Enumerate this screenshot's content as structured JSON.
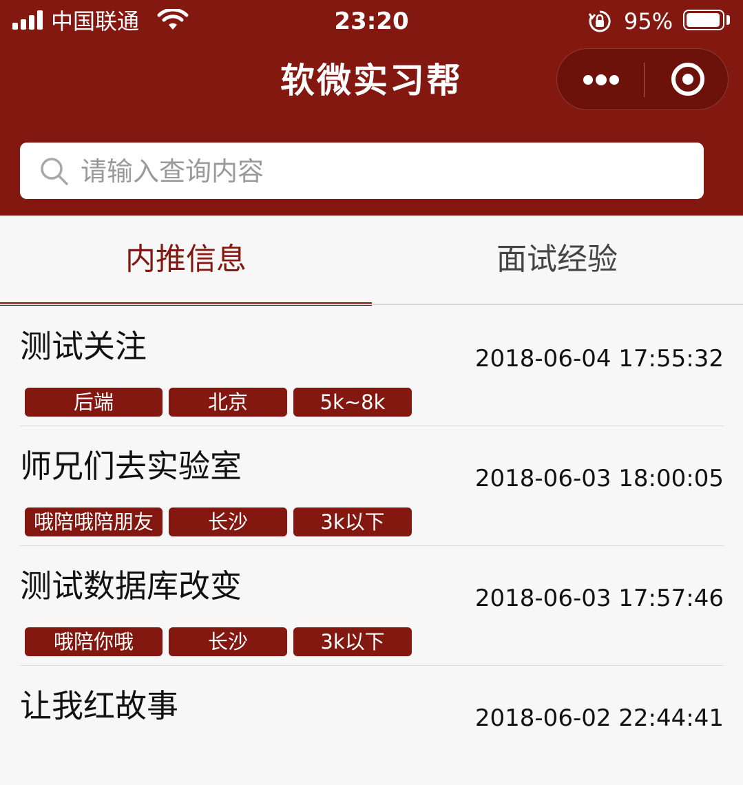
{
  "status_bar": {
    "carrier": "中国联通",
    "time": "23:20",
    "battery_percent": "95%",
    "battery_level": 0.95,
    "icons": [
      "signal-icon",
      "wifi-icon",
      "orientation-lock-icon",
      "battery-icon"
    ]
  },
  "header": {
    "title": "软微实习帮",
    "more_icon": "more-dots-icon",
    "close_icon": "target-icon"
  },
  "search": {
    "placeholder": "请输入查询内容",
    "value": "",
    "icon": "search-icon"
  },
  "tabs": [
    {
      "label": "内推信息",
      "active": true
    },
    {
      "label": "面试经验",
      "active": false
    }
  ],
  "posts": [
    {
      "title": "测试关注",
      "time": "2018-06-04 17:55:32",
      "tags": [
        "后端",
        "北京",
        "5k~8k"
      ]
    },
    {
      "title": "师兄们去实验室",
      "time": "2018-06-03 18:00:05",
      "tags": [
        "哦陪哦陪朋友",
        "长沙",
        "3k以下"
      ]
    },
    {
      "title": "测试数据库改变",
      "time": "2018-06-03 17:57:46",
      "tags": [
        "哦陪你哦",
        "长沙",
        "3k以下"
      ]
    },
    {
      "title": "让我红故事",
      "time": "2018-06-02 22:44:41",
      "tags": []
    }
  ],
  "colors": {
    "brand": "#831810",
    "background": "#f7f7f7",
    "tab_inactive": "#444444"
  }
}
